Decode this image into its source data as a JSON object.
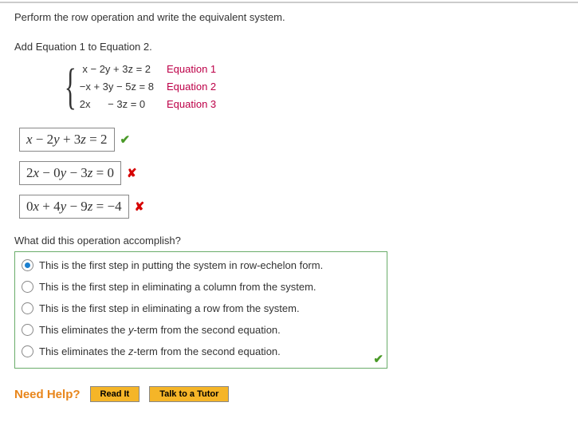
{
  "question": "Perform the row operation and write the equivalent system.",
  "instruction": "Add Equation 1 to Equation 2.",
  "system": {
    "rows": [
      " x − 2y + 3z = 2",
      "−x + 3y − 5z = 8",
      "2x      − 3z = 0"
    ],
    "labels": [
      "Equation 1",
      "Equation 2",
      "Equation 3"
    ]
  },
  "answers": [
    {
      "expr": "x − 2y + 3z = 2",
      "mark": "check"
    },
    {
      "expr": "2x − 0y − 3z = 0",
      "mark": "cross"
    },
    {
      "expr": "0x + 4y − 9z = −4",
      "mark": "cross"
    }
  ],
  "mc": {
    "prompt": "What did this operation accomplish?",
    "options": [
      "This is the first step in putting the system in row-echelon form.",
      "This is the first step in eliminating a column from the system.",
      "This is the first step in eliminating a row from the system.",
      "This eliminates the y-term from the second equation.",
      "This eliminates the z-term from the second equation."
    ],
    "selected": 0,
    "correct": true
  },
  "help": {
    "label": "Need Help?",
    "read": "Read It",
    "tutor": "Talk to a Tutor"
  },
  "marks": {
    "check": "✔",
    "cross": "✘"
  }
}
